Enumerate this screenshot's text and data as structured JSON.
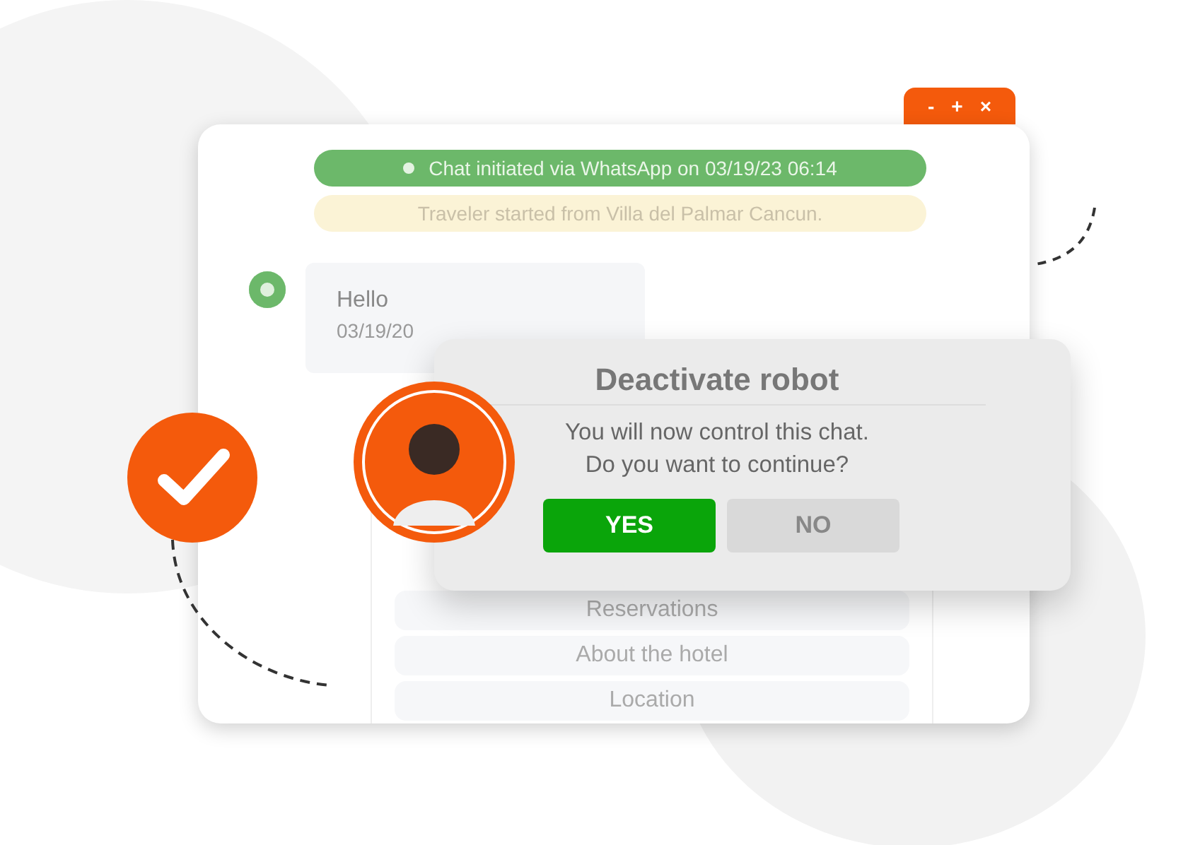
{
  "window": {
    "controls": [
      "-",
      "+",
      "×"
    ]
  },
  "chat": {
    "system_notice": "Chat initiated via WhatsApp on 03/19/23  06:14",
    "origin_notice": "Traveler started from Villa del Palmar Cancun.",
    "messages": [
      {
        "text": "Hello",
        "time": "03/19/20"
      }
    ],
    "menu_options": [
      "Reservations",
      "About the hotel",
      "Location"
    ]
  },
  "dialog": {
    "title": "Deactivate robot",
    "message_lines": [
      "You will now control this chat.",
      "Do you want to continue?"
    ],
    "buttons": [
      {
        "label": "YES",
        "kind": "confirm"
      },
      {
        "label": "NO",
        "kind": "cancel"
      }
    ]
  }
}
